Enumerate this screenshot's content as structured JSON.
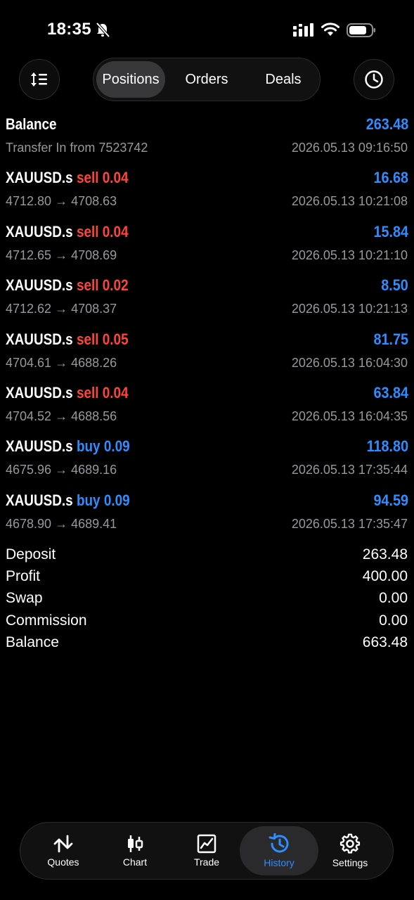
{
  "status_bar": {
    "time": "18:35"
  },
  "segments": [
    {
      "label": "Positions",
      "active": true
    },
    {
      "label": "Orders",
      "active": false
    },
    {
      "label": "Deals",
      "active": false
    }
  ],
  "deals": [
    {
      "symbol": "Balance",
      "side": "",
      "volume": "",
      "profit": "263.48",
      "details": "Transfer In from 7523742",
      "time": "2026.05.13 09:16:50"
    },
    {
      "symbol": "XAUUSD.s",
      "side": "sell",
      "volume": "0.04",
      "profit": "16.68",
      "details": "4712.80 → 4708.63",
      "time": "2026.05.13 10:21:08"
    },
    {
      "symbol": "XAUUSD.s",
      "side": "sell",
      "volume": "0.04",
      "profit": "15.84",
      "details": "4712.65 → 4708.69",
      "time": "2026.05.13 10:21:10"
    },
    {
      "symbol": "XAUUSD.s",
      "side": "sell",
      "volume": "0.02",
      "profit": "8.50",
      "details": "4712.62 → 4708.37",
      "time": "2026.05.13 10:21:13"
    },
    {
      "symbol": "XAUUSD.s",
      "side": "sell",
      "volume": "0.05",
      "profit": "81.75",
      "details": "4704.61 → 4688.26",
      "time": "2026.05.13 16:04:30"
    },
    {
      "symbol": "XAUUSD.s",
      "side": "sell",
      "volume": "0.04",
      "profit": "63.84",
      "details": "4704.52 → 4688.56",
      "time": "2026.05.13 16:04:35"
    },
    {
      "symbol": "XAUUSD.s",
      "side": "buy",
      "volume": "0.09",
      "profit": "118.80",
      "details": "4675.96 → 4689.16",
      "time": "2026.05.13 17:35:44"
    },
    {
      "symbol": "XAUUSD.s",
      "side": "buy",
      "volume": "0.09",
      "profit": "94.59",
      "details": "4678.90 → 4689.41",
      "time": "2026.05.13 17:35:47"
    }
  ],
  "summary": [
    {
      "label": "Deposit",
      "value": "263.48"
    },
    {
      "label": "Profit",
      "value": "400.00"
    },
    {
      "label": "Swap",
      "value": "0.00"
    },
    {
      "label": "Commission",
      "value": "0.00"
    },
    {
      "label": "Balance",
      "value": "663.48"
    }
  ],
  "tabs": [
    {
      "label": "Quotes",
      "icon": "arrows-up-down-icon",
      "active": false
    },
    {
      "label": "Chart",
      "icon": "candlestick-icon",
      "active": false
    },
    {
      "label": "Trade",
      "icon": "trend-chart-icon",
      "active": false
    },
    {
      "label": "History",
      "icon": "history-clock-icon",
      "active": true
    },
    {
      "label": "Settings",
      "icon": "gear-icon",
      "active": false
    }
  ],
  "colors": {
    "accent_blue": "#2e8dff",
    "sell_red": "#ff453a",
    "secondary_text": "#98989d",
    "background": "#000000"
  },
  "icons": {
    "toolbar_left": "sort-list-icon",
    "toolbar_right": "clock-icon",
    "status": [
      "bell-muted-icon",
      "cellular-signal-icon",
      "wifi-icon",
      "battery-icon"
    ]
  }
}
